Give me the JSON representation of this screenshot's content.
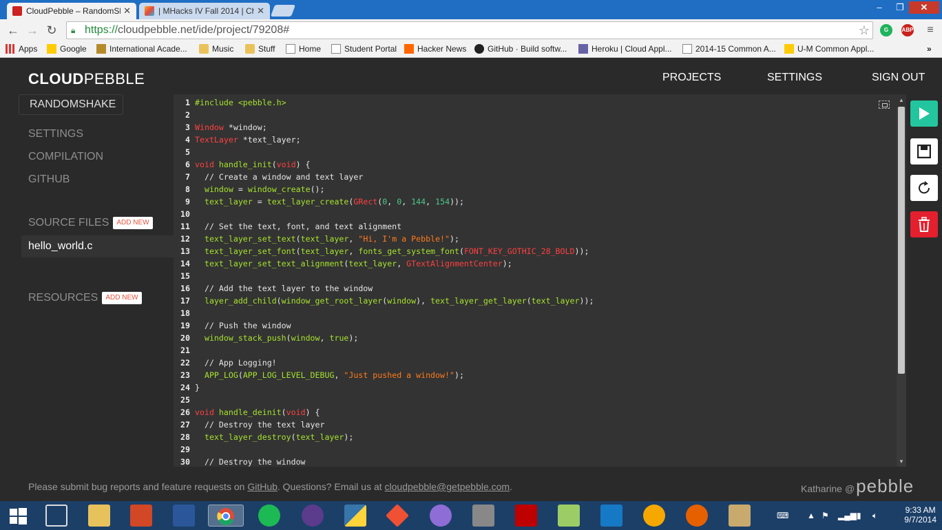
{
  "browser": {
    "tabs": [
      {
        "title": "CloudPebble – RandomSh",
        "close": "✕"
      },
      {
        "title": "| MHacks IV Fall 2014 | Ch",
        "close": "✕"
      }
    ],
    "window_controls": {
      "minimize": "‒",
      "maximize": "❐",
      "close": "✕"
    },
    "url": {
      "scheme": "https://",
      "rest": "cloudpebble.net/ide/project/79208#"
    },
    "extensions": [
      "ABP"
    ],
    "bookmarks": [
      {
        "label": "Apps",
        "icon": "apps-grid-icon"
      },
      {
        "label": "Google",
        "icon": "michigan-m-icon"
      },
      {
        "label": "International Acade...",
        "icon": "school-icon"
      },
      {
        "label": "Music",
        "icon": "folder-icon"
      },
      {
        "label": "Stuff",
        "icon": "folder-icon"
      },
      {
        "label": "Home",
        "icon": "page-icon"
      },
      {
        "label": "Student Portal",
        "icon": "page-icon"
      },
      {
        "label": "Hacker News",
        "icon": "ycombinator-icon"
      },
      {
        "label": "GitHub · Build softw...",
        "icon": "github-icon"
      },
      {
        "label": "Heroku | Cloud Appl...",
        "icon": "heroku-icon"
      },
      {
        "label": "2014-15 Common A...",
        "icon": "page-icon"
      },
      {
        "label": "U-M Common Appl...",
        "icon": "michigan-m-icon"
      }
    ]
  },
  "app": {
    "brand_bold": "CLOUD",
    "brand_light": "PEBBLE",
    "nav": {
      "projects": "PROJECTS",
      "settings": "SETTINGS",
      "sign_out": "SIGN OUT"
    },
    "project_name": "RANDOMSHAKE",
    "sidebar": {
      "settings": "SETTINGS",
      "compilation": "COMPILATION",
      "github": "GITHUB",
      "source_files": "SOURCE FILES",
      "add_new": "ADD NEW",
      "file": "hello_world.c",
      "resources": "RESOURCES",
      "add_new_resources": "ADD NEW"
    },
    "footer": {
      "prefix": "Please submit bug reports and feature requests on ",
      "github_link": "GitHub",
      "middle": ". Questions? Email us at ",
      "email_link": "cloudpebble@getpebble.com",
      "suffix": ".",
      "author": "Katharine",
      "at": "@",
      "pebble": "pebble"
    },
    "actions": {
      "run": "run",
      "save": "save",
      "restore": "restore",
      "delete": "delete"
    },
    "colors": {
      "run": "#23c59e",
      "delete": "#e4202e",
      "addnew_text": "#e8533a"
    }
  },
  "editor": {
    "lines": [
      [
        [
          "inc",
          "#include <pebble.h>"
        ]
      ],
      [],
      [
        [
          "kw",
          "Window"
        ],
        [
          "plain",
          " *window;"
        ]
      ],
      [
        [
          "kw",
          "TextLayer"
        ],
        [
          "plain",
          " *text_layer;"
        ]
      ],
      [],
      [
        [
          "kw",
          "void"
        ],
        [
          "plain",
          " "
        ],
        [
          "fn",
          "handle_init"
        ],
        [
          "plain",
          "("
        ],
        [
          "kw",
          "void"
        ],
        [
          "plain",
          ") {"
        ]
      ],
      [
        [
          "plain",
          "  // Create a window and text layer"
        ]
      ],
      [
        [
          "plain",
          "  "
        ],
        [
          "fn",
          "window"
        ],
        [
          "plain",
          " = "
        ],
        [
          "fn",
          "window_create"
        ],
        [
          "plain",
          "();"
        ]
      ],
      [
        [
          "plain",
          "  "
        ],
        [
          "fn",
          "text_layer"
        ],
        [
          "plain",
          " = "
        ],
        [
          "fn",
          "text_layer_create"
        ],
        [
          "plain",
          "("
        ],
        [
          "kw",
          "GRect"
        ],
        [
          "plain",
          "("
        ],
        [
          "num",
          "0"
        ],
        [
          "plain",
          ", "
        ],
        [
          "num",
          "0"
        ],
        [
          "plain",
          ", "
        ],
        [
          "num",
          "144"
        ],
        [
          "plain",
          ", "
        ],
        [
          "num",
          "154"
        ],
        [
          "plain",
          "));"
        ]
      ],
      [],
      [
        [
          "plain",
          "  // Set the text, font, and text alignment"
        ]
      ],
      [
        [
          "plain",
          "  "
        ],
        [
          "fn",
          "text_layer_set_text"
        ],
        [
          "plain",
          "("
        ],
        [
          "fn",
          "text_layer"
        ],
        [
          "plain",
          ", "
        ],
        [
          "str",
          "\"Hi, I'm a Pebble!\""
        ],
        [
          "plain",
          ");"
        ]
      ],
      [
        [
          "plain",
          "  "
        ],
        [
          "fn",
          "text_layer_set_font"
        ],
        [
          "plain",
          "("
        ],
        [
          "fn",
          "text_layer"
        ],
        [
          "plain",
          ", "
        ],
        [
          "fn",
          "fonts_get_system_font"
        ],
        [
          "plain",
          "("
        ],
        [
          "kw",
          "FONT_KEY_GOTHIC_28_BOLD"
        ],
        [
          "plain",
          "));"
        ]
      ],
      [
        [
          "plain",
          "  "
        ],
        [
          "fn",
          "text_layer_set_text_alignment"
        ],
        [
          "plain",
          "("
        ],
        [
          "fn",
          "text_layer"
        ],
        [
          "plain",
          ", "
        ],
        [
          "kw",
          "GTextAlignmentCenter"
        ],
        [
          "plain",
          ");"
        ]
      ],
      [],
      [
        [
          "plain",
          "  // Add the text layer to the window"
        ]
      ],
      [
        [
          "plain",
          "  "
        ],
        [
          "fn",
          "layer_add_child"
        ],
        [
          "plain",
          "("
        ],
        [
          "fn",
          "window_get_root_layer"
        ],
        [
          "plain",
          "("
        ],
        [
          "fn",
          "window"
        ],
        [
          "plain",
          "), "
        ],
        [
          "fn",
          "text_layer_get_layer"
        ],
        [
          "plain",
          "("
        ],
        [
          "fn",
          "text_layer"
        ],
        [
          "plain",
          "));"
        ]
      ],
      [],
      [
        [
          "plain",
          "  // Push the window"
        ]
      ],
      [
        [
          "plain",
          "  "
        ],
        [
          "fn",
          "window_stack_push"
        ],
        [
          "plain",
          "("
        ],
        [
          "fn",
          "window"
        ],
        [
          "plain",
          ", "
        ],
        [
          "fn",
          "true"
        ],
        [
          "plain",
          ");"
        ]
      ],
      [],
      [
        [
          "plain",
          "  // App Logging!"
        ]
      ],
      [
        [
          "plain",
          "  "
        ],
        [
          "fn",
          "APP_LOG"
        ],
        [
          "plain",
          "("
        ],
        [
          "fn",
          "APP_LOG_LEVEL_DEBUG"
        ],
        [
          "plain",
          ", "
        ],
        [
          "str",
          "\"Just pushed a window!\""
        ],
        [
          "plain",
          ");"
        ]
      ],
      [
        [
          "plain",
          "}"
        ]
      ],
      [],
      [
        [
          "kw",
          "void"
        ],
        [
          "plain",
          " "
        ],
        [
          "fn",
          "handle_deinit"
        ],
        [
          "plain",
          "("
        ],
        [
          "kw",
          "void"
        ],
        [
          "plain",
          ") {"
        ]
      ],
      [
        [
          "plain",
          "  // Destroy the text layer"
        ]
      ],
      [
        [
          "plain",
          "  "
        ],
        [
          "fn",
          "text_layer_destroy"
        ],
        [
          "plain",
          "("
        ],
        [
          "fn",
          "text_layer"
        ],
        [
          "plain",
          ");"
        ]
      ],
      [],
      [
        [
          "plain",
          "  // Destroy the window"
        ]
      ]
    ]
  },
  "taskbar": {
    "apps": [
      "windows-start-icon",
      "pebble-app-icon",
      "file-explorer-icon",
      "powerpoint-icon",
      "word-icon",
      "chrome-icon",
      "spotify-icon",
      "eclipse-icon",
      "python-icon",
      "git-icon",
      "github-desktop-icon",
      "wall-icon",
      "filezilla-icon",
      "notepad-icon",
      "wireshark-icon",
      "audacity-icon",
      "firefox-icon",
      "league-icon"
    ],
    "time": "9:33 AM",
    "date": "9/7/2014"
  }
}
